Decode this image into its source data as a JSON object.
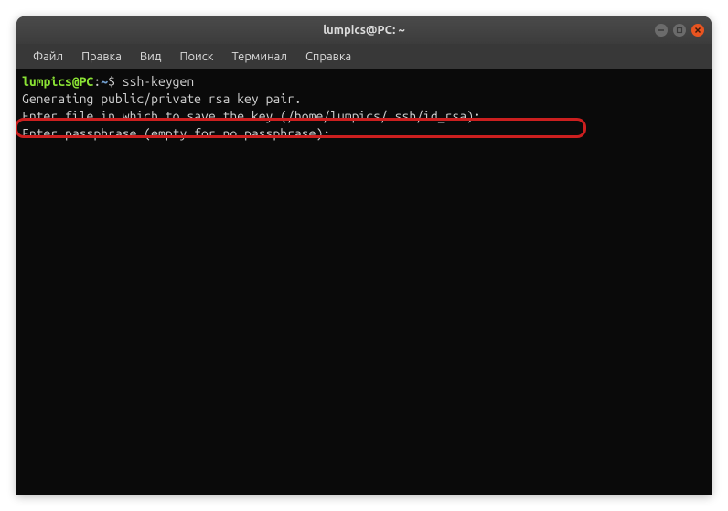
{
  "window": {
    "title": "lumpics@PC: ~"
  },
  "menubar": {
    "items": [
      {
        "label": "Файл"
      },
      {
        "label": "Правка"
      },
      {
        "label": "Вид"
      },
      {
        "label": "Поиск"
      },
      {
        "label": "Терминал"
      },
      {
        "label": "Справка"
      }
    ]
  },
  "terminal": {
    "prompt_user": "lumpics@PC",
    "prompt_sep": ":",
    "prompt_path": "~",
    "prompt_symbol": "$ ",
    "command": "ssh-keygen",
    "lines": [
      "Generating public/private rsa key pair.",
      "Enter file in which to save the key (/home/lumpics/.ssh/id_rsa):",
      "Enter passphrase (empty for no passphrase):"
    ]
  }
}
